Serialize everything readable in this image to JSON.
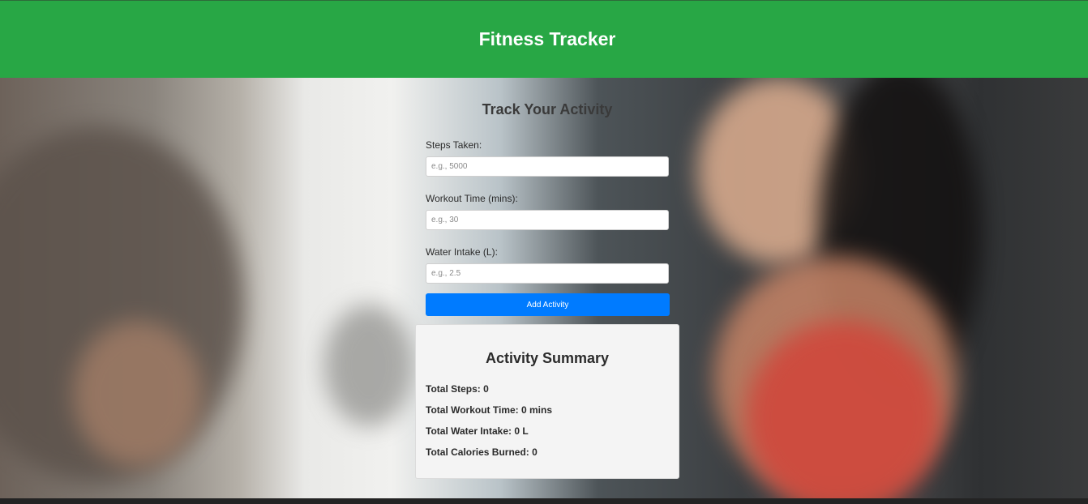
{
  "header": {
    "title": "Fitness Tracker"
  },
  "form": {
    "title": "Track Your Activity",
    "fields": [
      {
        "label": "Steps Taken:",
        "placeholder": "e.g., 5000",
        "value": ""
      },
      {
        "label": "Workout Time (mins):",
        "placeholder": "e.g., 30",
        "value": ""
      },
      {
        "label": "Water Intake (L):",
        "placeholder": "e.g., 2.5",
        "value": ""
      }
    ],
    "submit_label": "Add Activity"
  },
  "summary": {
    "title": "Activity Summary",
    "lines": [
      "Total Steps: 0",
      "Total Workout Time: 0 mins",
      "Total Water Intake: 0 L",
      "Total Calories Burned: 0"
    ]
  },
  "colors": {
    "header_bg": "#28a745",
    "button_bg": "#007bff",
    "summary_bg": "#f4f4f4"
  }
}
